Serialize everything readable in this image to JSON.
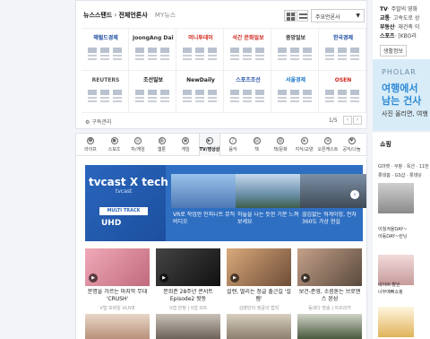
{
  "newsstand": {
    "title": "뉴스스탠드",
    "tab_all": "전체언론사",
    "tab_my": "MY뉴스",
    "select": "주요언론사",
    "subscribe": "구독관리",
    "page": "1/5",
    "prev": "‹",
    "next": "›",
    "papers": [
      {
        "name": "헤럴드경제",
        "color": "#1a4aa0"
      },
      {
        "name": "JoongAng Daily",
        "color": "#333333"
      },
      {
        "name": "머니투데이",
        "color": "#d0261c"
      },
      {
        "name": "석간 문화일보",
        "color": "#d0261c"
      },
      {
        "name": "중앙일보",
        "color": "#333333"
      },
      {
        "name": "한국경제",
        "color": "#1a4aa0"
      },
      {
        "name": "REUTERS",
        "color": "#555555"
      },
      {
        "name": "조선일보",
        "color": "#111111"
      },
      {
        "name": "NewDaily",
        "color": "#222222"
      },
      {
        "name": "스포츠조선",
        "color": "#1a4aa0"
      },
      {
        "name": "서울경제",
        "color": "#1a77c9"
      },
      {
        "name": "OSEN",
        "color": "#d0261c"
      }
    ]
  },
  "right_top": {
    "lines": [
      {
        "k": "TV",
        "v": "· 주말의 영화"
      },
      {
        "k": "교통",
        "v": "· 고속도로 상"
      },
      {
        "k": "부동산",
        "v": "· 재건축 이"
      },
      {
        "k": "스포츠",
        "v": "· [KBO라"
      }
    ],
    "button": "생활정보"
  },
  "ad": {
    "brand": "PHOLAR",
    "line1": "여행에서",
    "line2": "남는 건사",
    "line3": "사진 올리면, 여행"
  },
  "categories": [
    {
      "label": "라이프",
      "icon": "☻"
    },
    {
      "label": "스포츠",
      "icon": "●"
    },
    {
      "label": "자/게임",
      "icon": "◎"
    },
    {
      "label": "웹툰",
      "icon": "▦"
    },
    {
      "label": "게임",
      "icon": "▣"
    },
    {
      "label": "TV/영상상",
      "icon": "▶"
    },
    {
      "label": "음악",
      "icon": "♪"
    },
    {
      "label": "책",
      "icon": "▤"
    },
    {
      "label": "책/문화",
      "icon": "▥"
    },
    {
      "label": "지식/교양",
      "icon": "◈"
    },
    {
      "label": "오픈캐스트",
      "icon": "⊕"
    },
    {
      "label": "공익/나눔",
      "icon": "♥"
    }
  ],
  "tvcast": {
    "title": "tvcast X tech",
    "sub": "tvcast",
    "multi": "MULTI TRACK",
    "uhd": "UHD",
    "next": "›",
    "cards": [
      {
        "caption": "VR로 작업한 인피니트 뮤직비디오"
      },
      {
        "caption": "하늘을 나는 듯한 기분 느껴보세요"
      },
      {
        "caption": "끊김없는 워게이밍, 전차 360도 가상 현실"
      }
    ]
  },
  "videos": [
    {
      "title": "문명을 가르는 마지막 무대 'CRUSH'",
      "src": "V앱 모바일 VLIVE"
    },
    {
      "title": "문희준 28주년 콘서트 Episode2 왓동",
      "src": "V앱 한정 | V앱 IOS"
    },
    {
      "title": "설렌, 떨리는 정글 출근길 '설렘'",
      "src": "김병만의 정글의 법칙"
    },
    {
      "title": "보건-준영, 소름돋는 브로맨스 완성",
      "src": "동네다 방송 | 아프리카"
    }
  ],
  "shop": {
    "title": "쇼핑",
    "line1": "G마켓 · 쿠팡 · 옥션 · 11번",
    "line2": "롯데홈 · GS샵 · 롯데닷",
    "item1": "이월겨울DAY~",
    "item2": "아동DAY~런닝",
    "item3": "네이버 할인",
    "item4": "너무예뻐쇼핑"
  }
}
